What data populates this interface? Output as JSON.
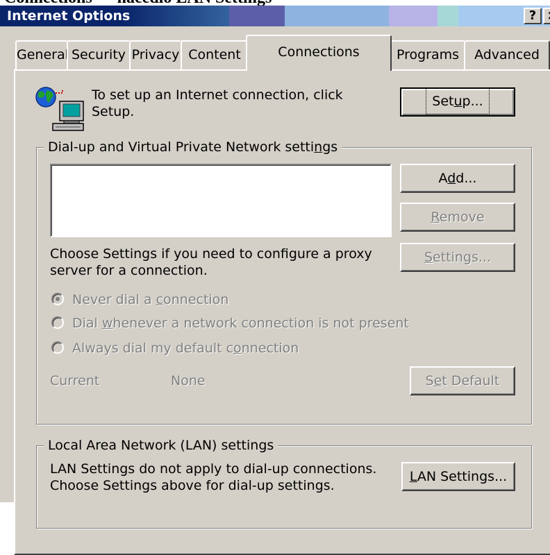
{
  "caption": "Connections — ñacêdio LAN Settings",
  "window": {
    "title": "Internet Options",
    "help_label": "?",
    "close_label": "×"
  },
  "tabs": [
    {
      "label": "General"
    },
    {
      "label": "Security"
    },
    {
      "label": "Privacy"
    },
    {
      "label": "Content"
    },
    {
      "label": "Connections",
      "selected": true
    },
    {
      "label": "Programs"
    },
    {
      "label": "Advanced"
    }
  ],
  "setup": {
    "icon": "globe-computer-icon",
    "description": "To set up an Internet connection, click Setup.",
    "button": {
      "pre": "Set",
      "mnemonic": "u",
      "post": "p..."
    }
  },
  "dialup": {
    "group_label": {
      "pre": "Dial-up and Virtual Private Network setti",
      "mnemonic": "n",
      "post": "gs"
    },
    "list_items": [],
    "add_button": {
      "pre": "A",
      "mnemonic": "d",
      "post": "d...",
      "enabled": true
    },
    "remove_button": {
      "pre": "",
      "mnemonic": "R",
      "post": "emove",
      "enabled": false
    },
    "settings_button": {
      "pre": "",
      "mnemonic": "S",
      "post": "ettings...",
      "enabled": false
    },
    "proxy_text": "Choose Settings if you need to configure a proxy server for a connection.",
    "radios": [
      {
        "pre": "Never dial a ",
        "mnemonic": "c",
        "post": "onnection",
        "checked": true
      },
      {
        "pre": "Dial ",
        "mnemonic": "w",
        "post": "henever a network connection is not present",
        "checked": false
      },
      {
        "pre": "Always dial my default c",
        "mnemonic": "o",
        "post": "nnection",
        "checked": false
      }
    ],
    "current_label": "Current",
    "current_value": "None",
    "set_default_button": {
      "pre": "S",
      "mnemonic": "e",
      "post": "t Default",
      "enabled": false
    }
  },
  "lan": {
    "group_label": "Local Area Network (LAN) settings",
    "description": "LAN Settings do not apply to dial-up connections. Choose Settings above for dial-up settings.",
    "button": {
      "pre": "",
      "mnemonic": "L",
      "post": "AN Settings..."
    }
  },
  "colors": {
    "dialog_bg": "#d4d0c8",
    "title_dark": "#0a246a",
    "title_light": "#a6caf0",
    "disabled_text": "#808080"
  }
}
